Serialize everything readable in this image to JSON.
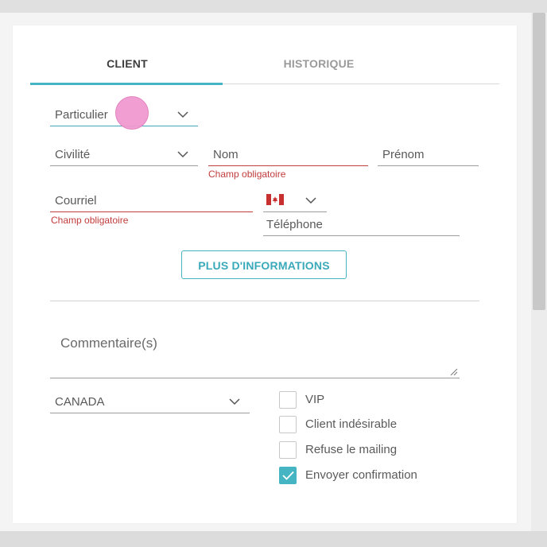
{
  "tabs": [
    {
      "label": "CLIENT",
      "active": true
    },
    {
      "label": "HISTORIQUE",
      "active": false
    }
  ],
  "form": {
    "client_type": "Particulier",
    "civilite_placeholder": "Civilité",
    "nom_placeholder": "Nom",
    "prenom_placeholder": "Prénom",
    "courriel_placeholder": "Courriel",
    "telephone_placeholder": "Téléphone",
    "phone_country_flag": "canada-flag-icon",
    "required_error": "Champ obligatoire",
    "more_info_button": "PLUS D'INFORMATIONS",
    "comments_placeholder": "Commentaire(s)",
    "country": "CANADA"
  },
  "checkboxes": [
    {
      "label": "VIP",
      "checked": false
    },
    {
      "label": "Client indésirable",
      "checked": false
    },
    {
      "label": "Refuse le mailing",
      "checked": false
    },
    {
      "label": "Envoyer confirmation",
      "checked": true
    }
  ],
  "colors": {
    "accent": "#45b5c4",
    "error": "#c23b3b",
    "cursor": "#f19ad0"
  }
}
